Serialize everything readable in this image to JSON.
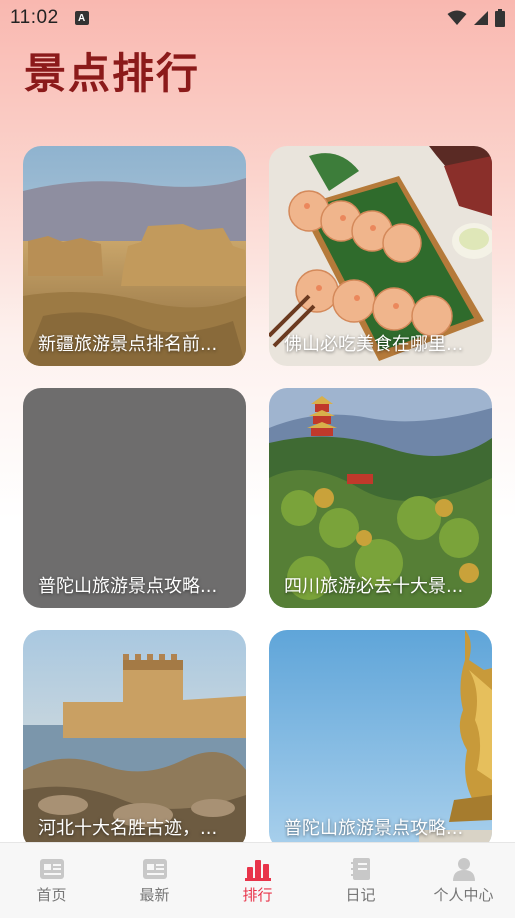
{
  "status_bar": {
    "time": "11:02",
    "notification_icon": "A"
  },
  "page": {
    "title": "景点排行"
  },
  "cards": [
    {
      "title": "新疆旅游景点排名前..."
    },
    {
      "title": "佛山必吃美食在哪里..."
    },
    {
      "title": "普陀山旅游景点攻略..."
    },
    {
      "title": "四川旅游必去十大景..."
    },
    {
      "title": "河北十大名胜古迹，..."
    },
    {
      "title": "普陀山旅游景点攻略..."
    }
  ],
  "tabs": [
    {
      "label": "首页",
      "icon": "home-icon"
    },
    {
      "label": "最新",
      "icon": "news-icon"
    },
    {
      "label": "排行",
      "icon": "ranking-icon"
    },
    {
      "label": "日记",
      "icon": "diary-icon"
    },
    {
      "label": "个人中心",
      "icon": "person-icon"
    }
  ],
  "colors": {
    "accent": "#e8344a",
    "title": "#8b1a1a",
    "inactive": "#777777"
  }
}
